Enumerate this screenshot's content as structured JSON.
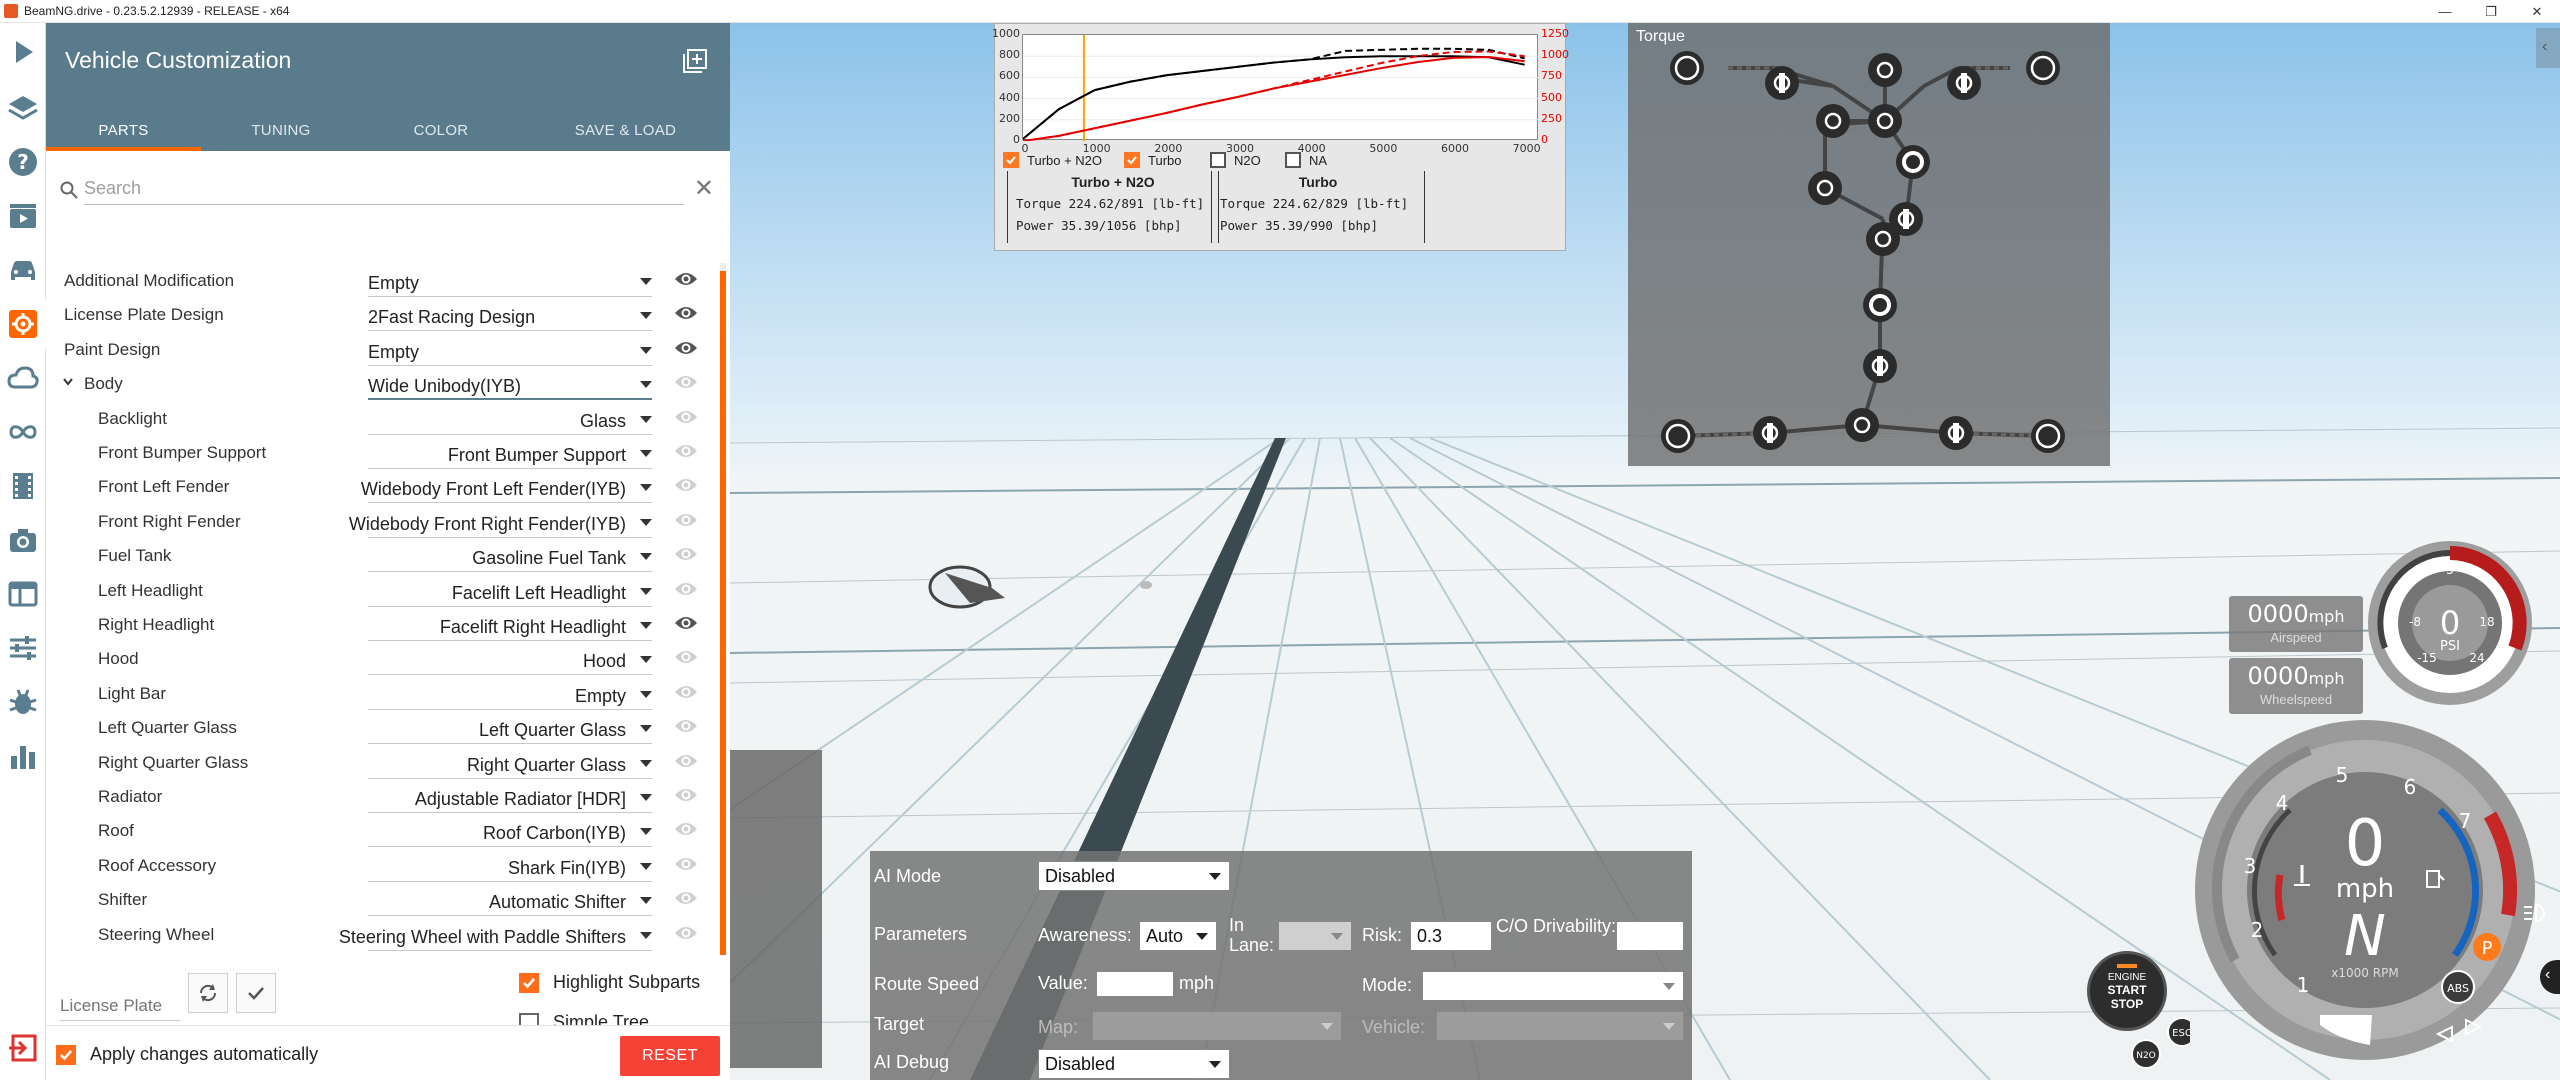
{
  "window": {
    "title": "BeamNG.drive - 0.23.5.2.12939 - RELEASE - x64",
    "controls": [
      "—",
      "❐",
      "✕"
    ]
  },
  "rail": {
    "icons": [
      "play-icon",
      "layers-icon",
      "help-icon",
      "clapper-icon",
      "car-icon",
      "gear-icon",
      "cloud-icon",
      "infinity-icon",
      "film-icon",
      "camera-icon",
      "window-icon",
      "sliders-icon",
      "bug-icon",
      "bar-chart-icon",
      "exit-icon"
    ],
    "active": "gear-icon"
  },
  "panel": {
    "title": "Vehicle Customization",
    "tabs": [
      {
        "label": "PARTS",
        "active": true
      },
      {
        "label": "TUNING",
        "active": false
      },
      {
        "label": "COLOR",
        "active": false
      },
      {
        "label": "SAVE & LOAD",
        "active": false
      }
    ],
    "search_placeholder": "Search",
    "clear": "✕",
    "parts": [
      {
        "label": "Additional Modification",
        "value": "Empty",
        "visible": true
      },
      {
        "label": "License Plate Design",
        "value": "2Fast Racing Design",
        "visible": true
      },
      {
        "label": "Paint Design",
        "value": "Empty",
        "visible": true
      },
      {
        "label": "Body",
        "value": "Wide Unibody(IYB)",
        "visible": false,
        "expanded": true
      },
      {
        "label": "Backlight",
        "value": "Glass",
        "visible": false
      },
      {
        "label": "Front Bumper Support",
        "value": "Front Bumper Support",
        "visible": false
      },
      {
        "label": "Front Left Fender",
        "value": "Widebody Front Left Fender(IYB)",
        "visible": false
      },
      {
        "label": "Front Right Fender",
        "value": "Widebody Front Right Fender(IYB)",
        "visible": false
      },
      {
        "label": "Fuel Tank",
        "value": "Gasoline Fuel Tank",
        "visible": false
      },
      {
        "label": "Left Headlight",
        "value": "Facelift Left Headlight",
        "visible": false
      },
      {
        "label": "Right Headlight",
        "value": "Facelift Right Headlight",
        "visible": true
      },
      {
        "label": "Hood",
        "value": "Hood",
        "visible": false
      },
      {
        "label": "Light Bar",
        "value": "Empty",
        "visible": false
      },
      {
        "label": "Left Quarter Glass",
        "value": "Left Quarter Glass",
        "visible": false
      },
      {
        "label": "Right Quarter Glass",
        "value": "Right Quarter Glass",
        "visible": false
      },
      {
        "label": "Radiator",
        "value": "Adjustable Radiator [HDR]",
        "visible": false
      },
      {
        "label": "Roof",
        "value": "Roof Carbon(IYB)",
        "visible": false
      },
      {
        "label": "Roof Accessory",
        "value": "Shark Fin(IYB)",
        "visible": false
      },
      {
        "label": "Shifter",
        "value": "Automatic Shifter",
        "visible": false
      },
      {
        "label": "Steering Wheel",
        "value": "Steering Wheel with Paddle Shifters",
        "visible": false
      }
    ],
    "license_plate_placeholder": "License Plate",
    "highlight_subparts": {
      "label": "Highlight Subparts",
      "checked": true
    },
    "simple_tree": {
      "label": "Simple Tree",
      "checked": false
    },
    "apply_auto": {
      "label": "Apply changes automatically",
      "checked": true
    },
    "reset_label": "RESET"
  },
  "torque_graph": {
    "left_ticks": [
      "1000",
      "800",
      "600",
      "400",
      "200",
      "0"
    ],
    "right_ticks": [
      "1250",
      "1000",
      "750",
      "500",
      "250",
      "0"
    ],
    "x_ticks": [
      "0",
      "1000",
      "2000",
      "3000",
      "4000",
      "5000",
      "6000",
      "7000"
    ],
    "legend": [
      {
        "label": "Turbo + N2O",
        "checked": true
      },
      {
        "label": "Turbo",
        "checked": true
      },
      {
        "label": "N2O",
        "checked": false
      },
      {
        "label": "NA",
        "checked": false
      }
    ],
    "boxes": [
      {
        "title": "Turbo + N2O",
        "torque": "Torque 224.62/891 [lb-ft]",
        "power": "Power  35.39/1056 [bhp]"
      },
      {
        "title": "Turbo",
        "torque": "Torque 224.62/829 [lb-ft]",
        "power": "Power  35.39/990  [bhp]"
      }
    ],
    "colors": {
      "torque": "#000000",
      "power": "#e60000",
      "rpm_marker": "#ffa500"
    }
  },
  "chart_data": {
    "type": "line",
    "x": [
      0,
      500,
      1000,
      1500,
      2000,
      2500,
      3000,
      3500,
      4000,
      4500,
      5000,
      5500,
      6000,
      6500,
      7000
    ],
    "xlim": [
      0,
      7200
    ],
    "ylim": [
      0,
      1000
    ],
    "y2lim": [
      0,
      1250
    ],
    "rpm_marker": 850,
    "series": [
      {
        "name": "Turbo + N2O",
        "quantity": "torque",
        "dashed": true,
        "values": [
          20,
          300,
          480,
          560,
          620,
          660,
          700,
          740,
          770,
          850,
          860,
          870,
          870,
          860,
          780
        ]
      },
      {
        "name": "Turbo",
        "quantity": "torque",
        "dashed": false,
        "values": [
          20,
          300,
          480,
          560,
          620,
          660,
          700,
          740,
          770,
          790,
          800,
          800,
          800,
          790,
          720
        ]
      },
      {
        "name": "Turbo + N2O",
        "quantity": "power",
        "dashed": true,
        "values": [
          0,
          60,
          150,
          240,
          330,
          430,
          520,
          620,
          720,
          820,
          920,
          1000,
          1050,
          1056,
          1000
        ]
      },
      {
        "name": "Turbo",
        "quantity": "power",
        "dashed": false,
        "values": [
          0,
          60,
          150,
          240,
          330,
          430,
          520,
          620,
          700,
          780,
          860,
          930,
          980,
          990,
          940
        ]
      }
    ]
  },
  "torque_tree": {
    "title": "Torque"
  },
  "speed": {
    "airspeed": {
      "value": "0000",
      "unit": "mph",
      "label": "Airspeed"
    },
    "wheelspeed": {
      "value": "0000",
      "unit": "mph",
      "label": "Wheelspeed"
    }
  },
  "boost_gauge": {
    "value": "0",
    "unit": "PSI",
    "ticks": [
      "5",
      "-8",
      "18",
      "-15",
      "24"
    ]
  },
  "main_gauge": {
    "speed": "0",
    "unit": "mph",
    "gear": "N",
    "rpm_label": "x1000 RPM",
    "rpm_ticks": [
      "1",
      "2",
      "3",
      "4",
      "5",
      "6",
      "7"
    ],
    "indicators": [
      "P",
      "ABS",
      "ESC",
      "N2O"
    ]
  },
  "engine_button": {
    "line1": "ENGINE",
    "line2": "START",
    "line3": "STOP"
  },
  "ai": {
    "mode_label": "AI Mode",
    "mode_value": "Disabled",
    "params_label": "Parameters",
    "awareness_label": "Awareness:",
    "awareness_value": "Auto",
    "in_lane_label": "In Lane:",
    "risk_label": "Risk:",
    "risk_value": "0.3",
    "co_label": "C/O Drivability:",
    "route_label": "Route Speed",
    "value_label": "Value:",
    "mph": "mph",
    "mode2_label": "Mode:",
    "target_label": "Target",
    "map_label": "Map:",
    "vehicle_label": "Vehicle:",
    "debug_label": "AI Debug",
    "debug_value": "Disabled"
  }
}
